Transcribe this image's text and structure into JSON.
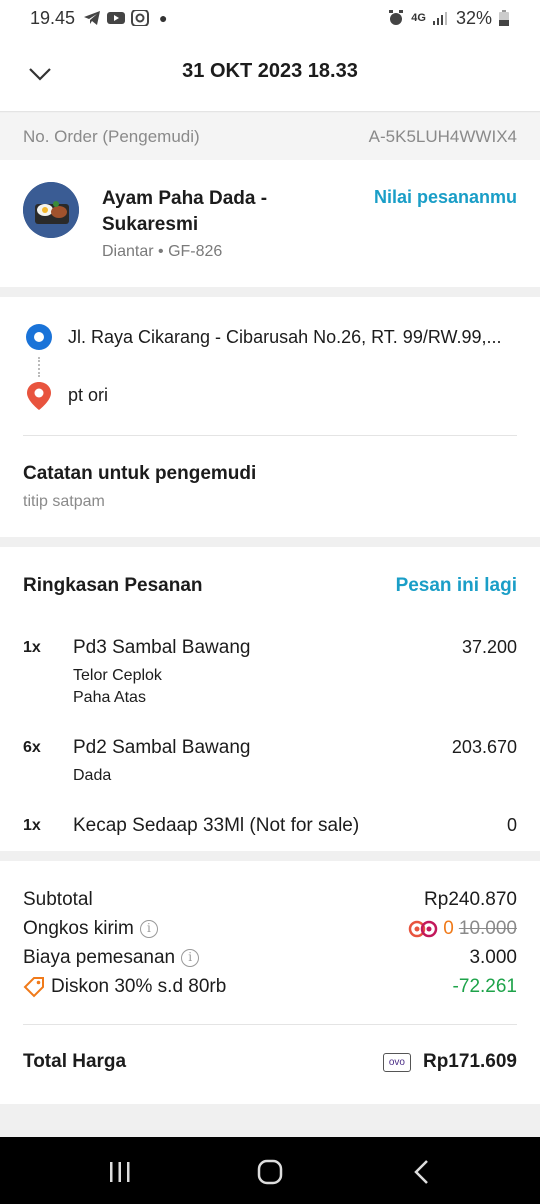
{
  "status_bar": {
    "time": "19.45",
    "network": "4G",
    "battery": "32%"
  },
  "header": {
    "title": "31 OKT 2023 18.33"
  },
  "order": {
    "label": "No. Order (Pengemudi)",
    "value": "A-5K5LUH4WWIX4"
  },
  "merchant": {
    "name": "Ayam Paha Dada - Sukaresmi",
    "subtitle": "Diantar • GF-826",
    "rate_label": "Nilai pesananmu"
  },
  "route": {
    "pickup": "Jl. Raya Cikarang - Cibarusah No.26, RT. 99/RW.99,...",
    "destination": "pt ori",
    "note_title": "Catatan untuk pengemudi",
    "note_text": "titip satpam"
  },
  "summary": {
    "title": "Ringkasan Pesanan",
    "reorder_label": "Pesan ini lagi",
    "items": [
      {
        "qty": "1x",
        "name": "Pd3 Sambal Bawang",
        "price": "37.200",
        "options": [
          "Telor Ceplok",
          "Paha Atas"
        ]
      },
      {
        "qty": "6x",
        "name": "Pd2 Sambal Bawang",
        "price": "203.670",
        "options": [
          "Dada"
        ]
      },
      {
        "qty": "1x",
        "name": "Kecap Sedaap 33Ml (Not for sale)",
        "price": "0",
        "options": []
      }
    ]
  },
  "totals": {
    "subtotal_label": "Subtotal",
    "subtotal_value": "Rp240.870",
    "delivery_label": "Ongkos kirim",
    "delivery_value": "0",
    "delivery_original": "10.000",
    "fee_label": "Biaya pemesanan",
    "fee_value": "3.000",
    "discount_label": "Diskon 30% s.d 80rb",
    "discount_value": "-72.261",
    "total_label": "Total Harga",
    "payment_method": "ovo",
    "total_value": "Rp171.609"
  },
  "colors": {
    "accent": "#1a9ec7",
    "discount": "#1ea34a",
    "pickup": "#1a73d8",
    "destination": "#e8543e",
    "promo": "#f07a1a"
  }
}
